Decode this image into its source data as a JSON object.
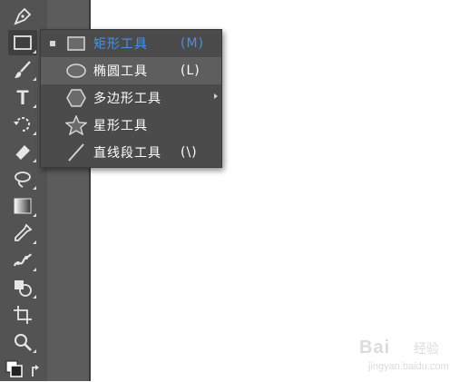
{
  "tools": [
    {
      "name": "pen-tool",
      "icon": "pen-icon"
    },
    {
      "name": "rectangle-tool",
      "icon": "rectangle-icon"
    },
    {
      "name": "paintbrush-tool",
      "icon": "paintbrush-icon"
    },
    {
      "name": "type-tool",
      "icon": "type-icon",
      "text": "T"
    },
    {
      "name": "rotate-tool",
      "icon": "rotate-icon"
    },
    {
      "name": "eraser-tool",
      "icon": "eraser-icon"
    },
    {
      "name": "lasso-tool",
      "icon": "lasso-icon"
    },
    {
      "name": "gradient-tool",
      "icon": "gradient-icon"
    },
    {
      "name": "eyedropper-tool",
      "icon": "eyedropper-icon"
    },
    {
      "name": "puppet-warp-tool",
      "icon": "puppet-warp-icon"
    },
    {
      "name": "shape-builder-tool",
      "icon": "shape-builder-icon"
    },
    {
      "name": "artboard-tool",
      "icon": "artboard-icon"
    },
    {
      "name": "zoom-tool",
      "icon": "zoom-icon"
    },
    {
      "name": "fill-stroke-swap",
      "icon": "fill-stroke-icon"
    }
  ],
  "flyout": {
    "items": [
      {
        "label": "矩形工具",
        "shortcut": "(M)",
        "icon": "rectangle-icon",
        "selected": true
      },
      {
        "label": "椭圆工具",
        "shortcut": "(L)",
        "icon": "ellipse-icon",
        "hover": true
      },
      {
        "label": "多边形工具",
        "shortcut": "",
        "icon": "polygon-icon"
      },
      {
        "label": "星形工具",
        "shortcut": "",
        "icon": "star-icon"
      },
      {
        "label": "直线段工具",
        "shortcut": "(\\)",
        "icon": "line-segment-icon"
      }
    ]
  },
  "watermark": {
    "brand": "Bai",
    "sub": "经验",
    "url": "jingyan.baidu.com"
  },
  "colors": {
    "toolbar": "#535353",
    "flyout": "#4b4b4b",
    "selected_text": "#4a90e8",
    "canvas": "#ffffff"
  }
}
